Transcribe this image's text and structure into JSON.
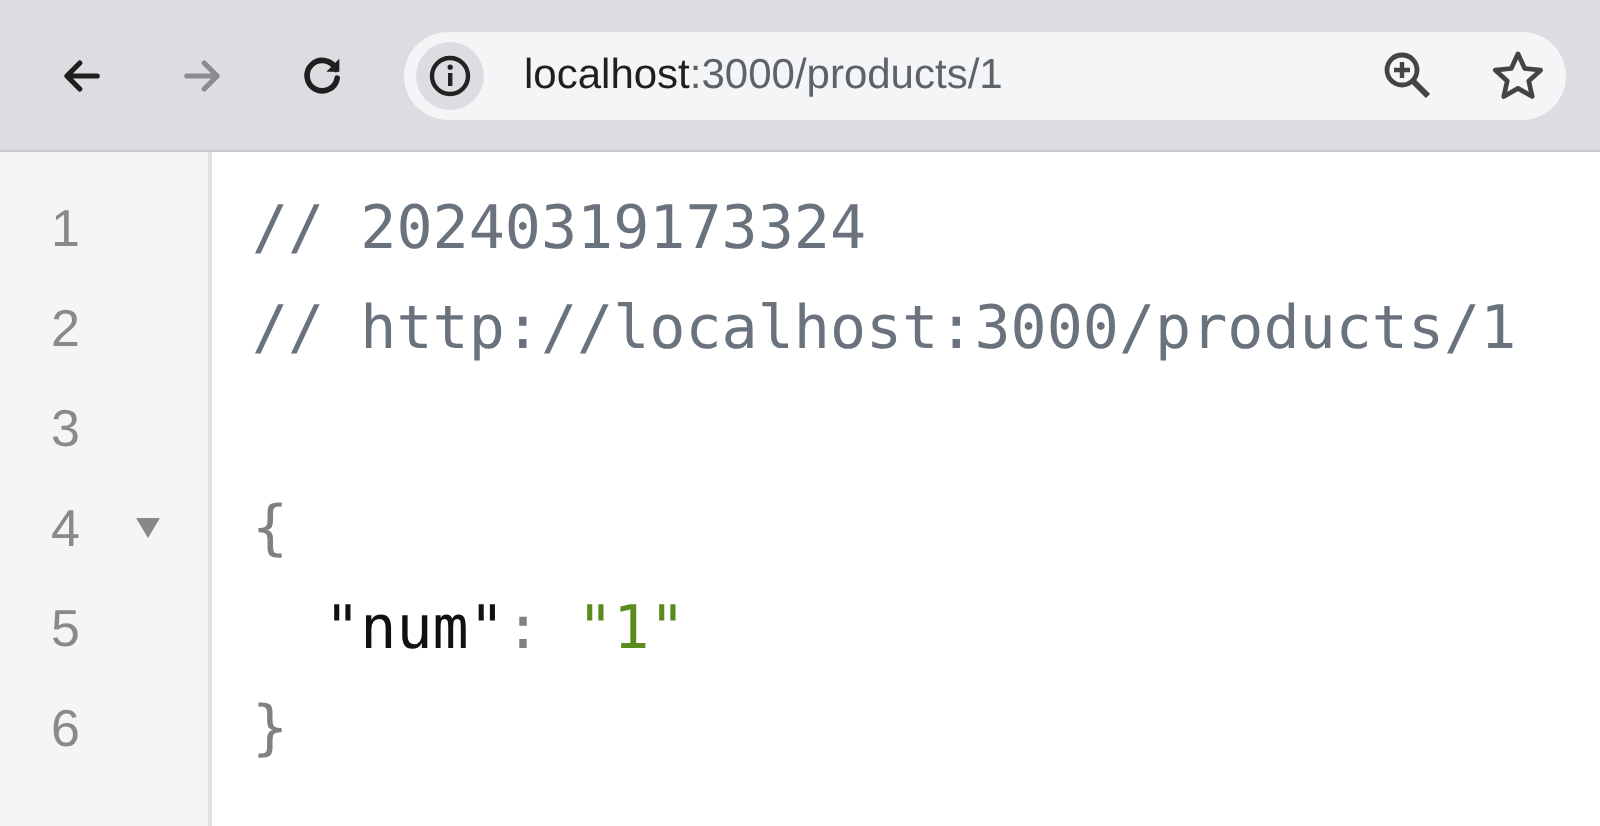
{
  "toolbar": {
    "nav_buttons": [
      {
        "kind": "back",
        "disabled": false
      },
      {
        "kind": "forward",
        "disabled": true
      },
      {
        "kind": "reload",
        "disabled": false
      }
    ],
    "address": {
      "host": "localhost",
      "path": ":3000/products/1"
    }
  },
  "code_lines": [
    {
      "number": "1",
      "tokens": [
        {
          "kind": "comment",
          "text": "// 20240319173324"
        }
      ]
    },
    {
      "number": "2",
      "tokens": [
        {
          "kind": "comment",
          "text": "// http://localhost:3000/products/1"
        }
      ]
    },
    {
      "number": "3"
    },
    {
      "number": "4",
      "fold": {
        "expanded": true
      },
      "tokens": [
        {
          "kind": "punct",
          "text": "{"
        }
      ]
    },
    {
      "number": "5",
      "tokens": [
        {
          "kind": "key",
          "text": "  \"num\""
        },
        {
          "kind": "punct",
          "text": ": "
        },
        {
          "kind": "string",
          "text": "\"1\""
        }
      ]
    },
    {
      "number": "6",
      "tokens": [
        {
          "kind": "punct",
          "text": "}"
        }
      ]
    }
  ]
}
